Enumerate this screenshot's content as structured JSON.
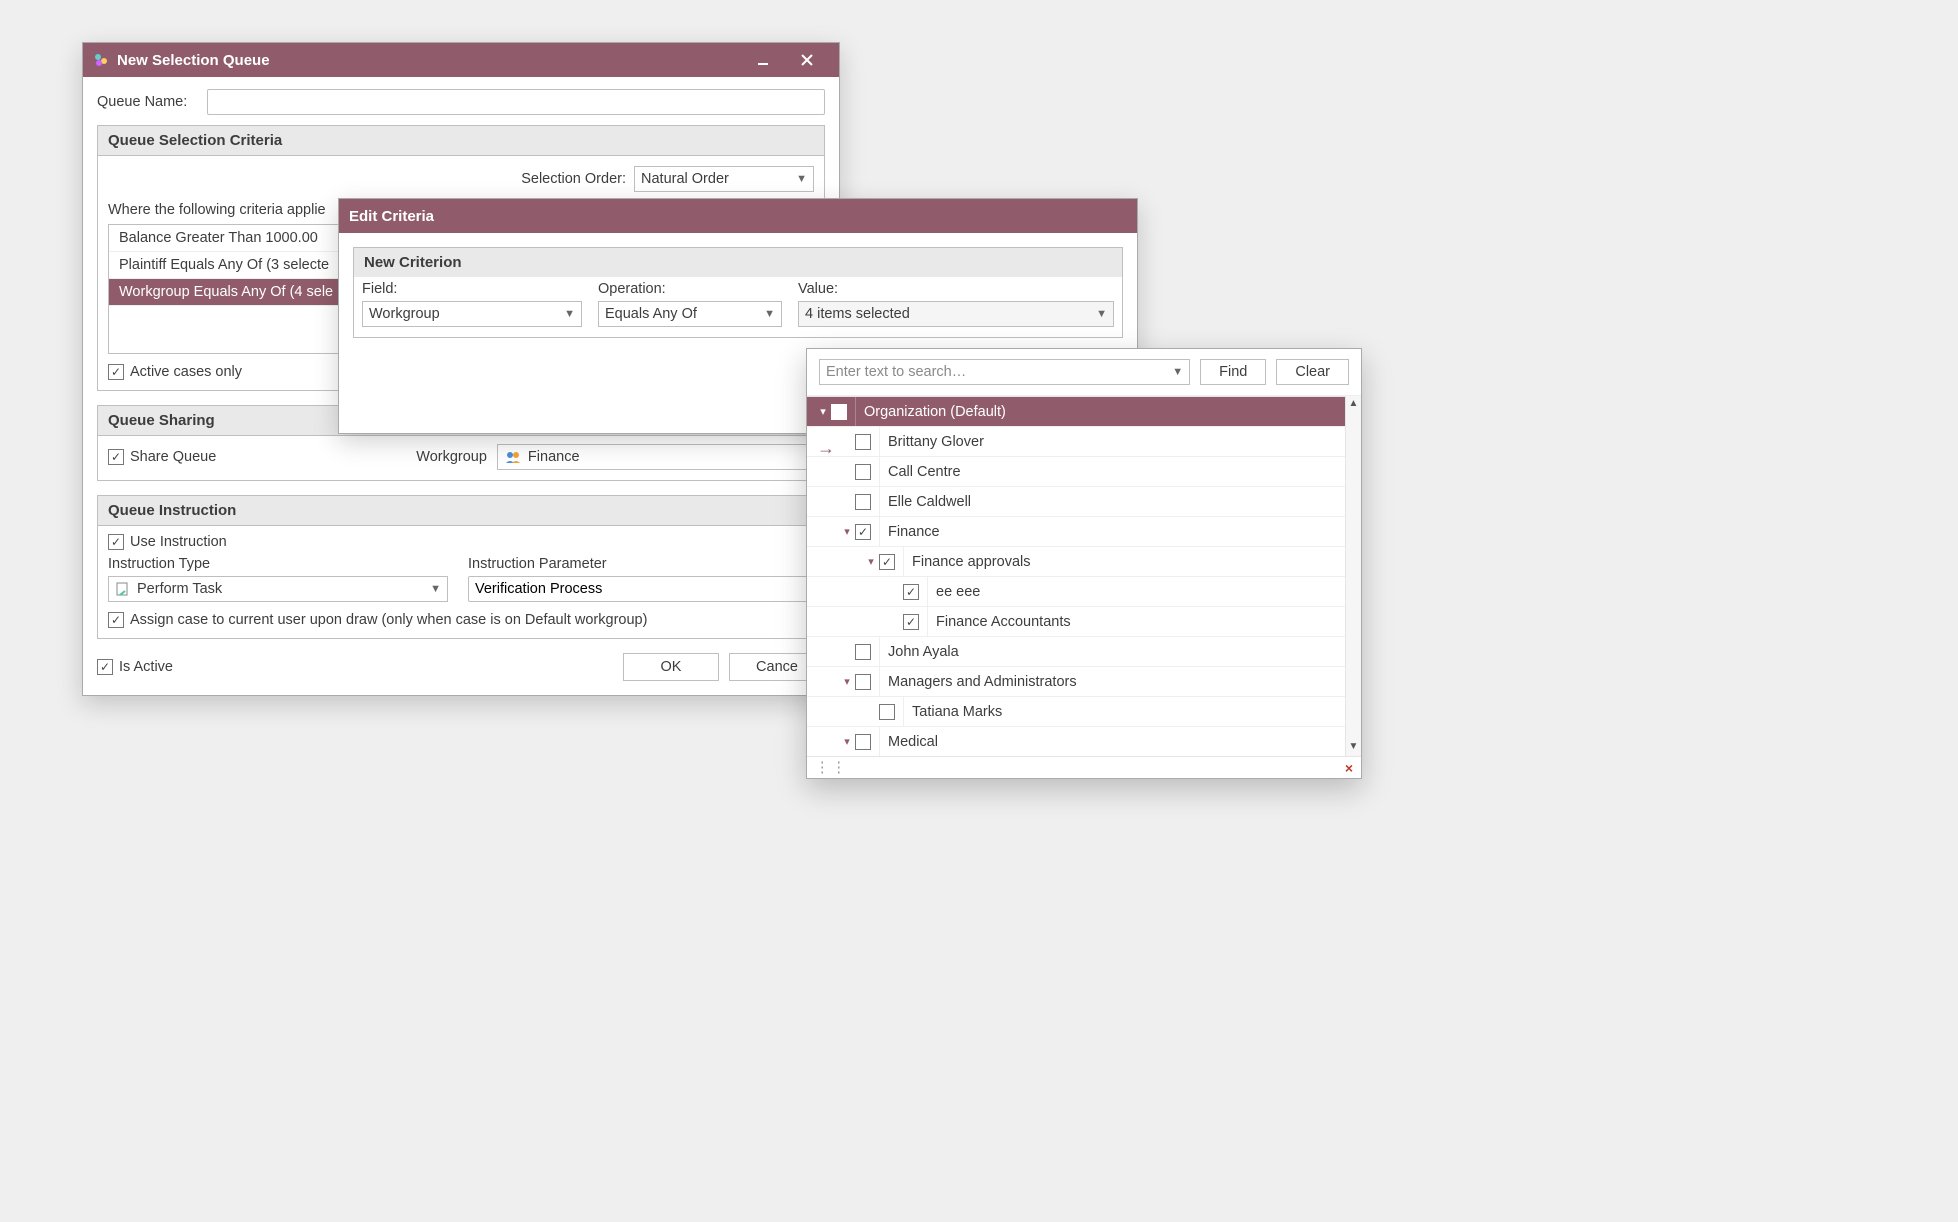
{
  "mainWindow": {
    "title": "New Selection Queue",
    "queueNameLabel": "Queue Name:",
    "queueNameValue": "",
    "criteria": {
      "title": "Queue Selection Criteria",
      "selectionOrderLabel": "Selection Order:",
      "selectionOrderValue": "Natural Order",
      "intro": "Where the following criteria applie",
      "items": [
        "Balance Greater Than 1000.00",
        "Plaintiff Equals Any Of (3 selecte",
        "Workgroup Equals Any Of (4 sele"
      ],
      "selectedIndex": 2,
      "activeOnlyLabel": "Active cases only",
      "activeOnlyChecked": true
    },
    "sharing": {
      "title": "Queue Sharing",
      "shareLabel": "Share Queue",
      "shareChecked": true,
      "workgroupLabel": "Workgroup",
      "workgroupValue": "Finance"
    },
    "instruction": {
      "title": "Queue Instruction",
      "useLabel": "Use Instruction",
      "useChecked": true,
      "typeLabel": "Instruction Type",
      "typeValue": "Perform Task",
      "paramLabel": "Instruction Parameter",
      "paramValue": "Verification Process",
      "assignLabel": "Assign case to current user upon draw (only when case is on Default workgroup)",
      "assignChecked": true
    },
    "footer": {
      "isActiveLabel": "Is Active",
      "isActiveChecked": true,
      "okLabel": "OK",
      "cancelLabel": "Cance"
    }
  },
  "editCriteria": {
    "title": "Edit Criteria",
    "groupTitle": "New Criterion",
    "fieldLabel": "Field:",
    "fieldValue": "Workgroup",
    "operationLabel": "Operation:",
    "operationValue": "Equals Any Of",
    "valueLabel": "Value:",
    "valueValue": "4 items selected"
  },
  "treePanel": {
    "searchPlaceholder": "Enter text to search…",
    "findLabel": "Find",
    "clearLabel": "Clear",
    "nodes": [
      {
        "label": "Organization (Default)",
        "level": 0,
        "expanded": true,
        "checked": false,
        "selected": true
      },
      {
        "label": "Brittany Glover",
        "level": 1,
        "expanded": null,
        "checked": false
      },
      {
        "label": "Call Centre",
        "level": 1,
        "expanded": null,
        "checked": false
      },
      {
        "label": "Elle Caldwell",
        "level": 1,
        "expanded": null,
        "checked": false
      },
      {
        "label": "Finance",
        "level": 1,
        "expanded": true,
        "checked": true
      },
      {
        "label": "Finance approvals",
        "level": 2,
        "expanded": true,
        "checked": true
      },
      {
        "label": "ee eee",
        "level": 3,
        "expanded": null,
        "checked": true
      },
      {
        "label": "Finance Accountants",
        "level": 3,
        "expanded": null,
        "checked": true
      },
      {
        "label": "John Ayala",
        "level": 1,
        "expanded": null,
        "checked": false
      },
      {
        "label": "Managers and Administrators",
        "level": 1,
        "expanded": true,
        "checked": false
      },
      {
        "label": "Tatiana Marks",
        "level": 2,
        "expanded": null,
        "checked": false
      },
      {
        "label": "Medical",
        "level": 1,
        "expanded": true,
        "checked": false
      }
    ]
  }
}
